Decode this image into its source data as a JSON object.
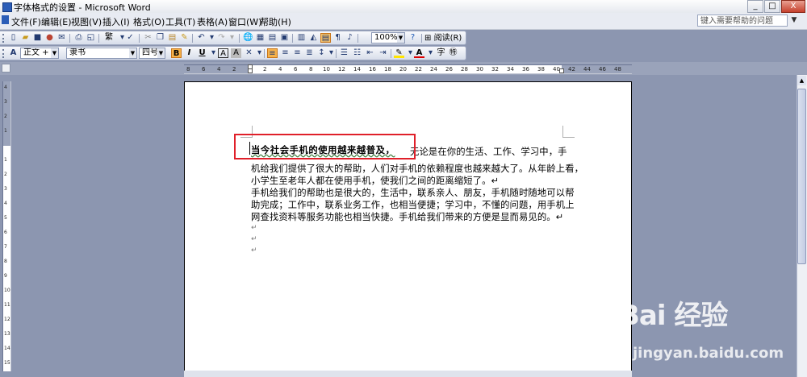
{
  "window": {
    "title": "字体格式的设置 - Microsoft Word",
    "minimize": "_",
    "maximize": "□",
    "close": "X"
  },
  "menu": {
    "items": [
      "文件(F)",
      "编辑(E)",
      "视图(V)",
      "插入(I)",
      "格式(O)",
      "工具(T)",
      "表格(A)",
      "窗口(W)",
      "帮助(H)"
    ],
    "help_placeholder": "键入需要帮助的问题"
  },
  "toolbar_standard": {
    "zoom": "100%",
    "read_label": "阅读(R)",
    "simplified_label": "繁"
  },
  "toolbar_format": {
    "style": "正文 + (中)",
    "font": "隶书",
    "size": "四号",
    "bold": "B",
    "italic": "I",
    "underline": "U",
    "char_border": "A",
    "char_shading": "A"
  },
  "ruler": {
    "ticks": [
      "8",
      "6",
      "4",
      "2",
      "",
      "2",
      "4",
      "6",
      "8",
      "10",
      "12",
      "14",
      "16",
      "18",
      "20",
      "22",
      "24",
      "26",
      "28",
      "30",
      "32",
      "34",
      "36",
      "38",
      "40",
      "42",
      "44",
      "46",
      "48"
    ]
  },
  "vruler_ticks": [
    "4",
    "3",
    "2",
    "1",
    "",
    "1",
    "2",
    "3",
    "4",
    "5",
    "6",
    "7",
    "8",
    "9",
    "10",
    "11",
    "12",
    "13",
    "14",
    "15",
    "16"
  ],
  "document": {
    "highlighted_text": "当今社会手机的使用越来越普及，",
    "lines": [
      "无论是在你的生活、工作、学习中，手",
      "机给我们提供了很大的帮助，人们对手机的依赖程度也越来越大了。从年龄上看，",
      "小学生至老年人都在使用手机，使我们之间的距离缩短了。↵",
      "手机给我们的帮助也是很大的，生活中，联系亲人、朋友，手机随时随地可以帮",
      "助完成；工作中，联系业务工作，也相当便捷；学习中，不懂的问题，用手机上",
      "网查找资料等服务功能也相当快捷。手机给我们带来的方便是显而易见的。↵"
    ],
    "para_mark": "↵"
  },
  "watermark": {
    "brand": "Bai 经验",
    "url": "jingyan.baidu.com"
  }
}
